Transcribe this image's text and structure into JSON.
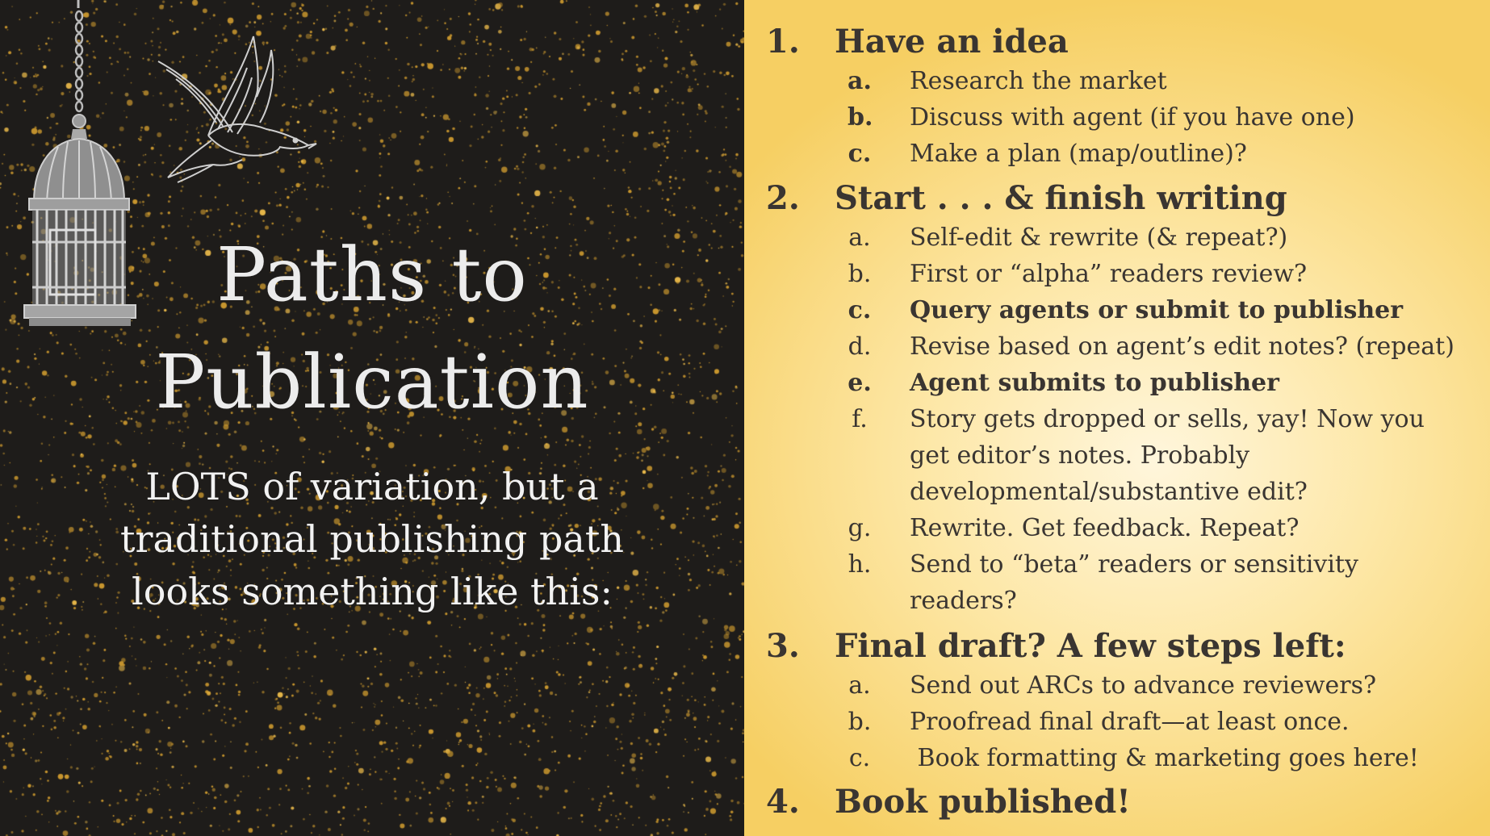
{
  "left": {
    "title_line1": "Paths to",
    "title_line2": "Publication",
    "subtitle_line1": "LOTS of variation, but a",
    "subtitle_line2": "traditional publishing path",
    "subtitle_line3": "looks something like this:",
    "illustrations": [
      "birdcage-icon",
      "swallow-icon"
    ],
    "colors": {
      "background": "#1e1c1a",
      "sparkle": "#c8962e",
      "text": "#ececec"
    }
  },
  "steps": [
    {
      "num": "1.",
      "title": "Have an idea",
      "subs": [
        {
          "letter": "a.",
          "text": "Research the market",
          "bold_letter": true
        },
        {
          "letter": "b.",
          "text": "Discuss with agent (if you have one)",
          "bold_letter": true
        },
        {
          "letter": "c.",
          "text": "Make a plan (map/outline)?",
          "bold_letter": true
        }
      ]
    },
    {
      "num": "2.",
      "title": "Start . . . & finish writing",
      "subs": [
        {
          "letter": "a.",
          "text": "Self-edit & rewrite (& repeat?)"
        },
        {
          "letter": "b.",
          "text": "First or “alpha” readers review?"
        },
        {
          "letter": "c.",
          "text": "Query agents or submit to publisher",
          "bold": true
        },
        {
          "letter": "d.",
          "text": "Revise based on agent’s edit notes? (repeat)"
        },
        {
          "letter": "e.",
          "text": "Agent submits to publisher",
          "bold": true
        },
        {
          "letter": "f.",
          "text": "Story gets dropped or sells, yay! Now you",
          "cont1": "get editor’s notes. Probably",
          "cont2": "developmental/substantive edit?"
        },
        {
          "letter": "g.",
          "text": "Rewrite. Get feedback. Repeat?"
        },
        {
          "letter": "h.",
          "text": "Send to “beta” readers or sensitivity",
          "cont1": "readers?"
        }
      ]
    },
    {
      "num": "3.",
      "title": "Final draft? A few steps left:",
      "subs": [
        {
          "letter": "a.",
          "text": "Send out ARCs to advance reviewers?"
        },
        {
          "letter": "b.",
          "text": "Proofread final draft—at least once."
        },
        {
          "letter": "c.",
          "text": " Book formatting & marketing goes here!"
        }
      ]
    },
    {
      "num": "4.",
      "title": "Book published!"
    }
  ],
  "colors": {
    "list_text": "#3a3531",
    "gold_light": "#fff6dc",
    "gold_dark": "#f6cf63"
  }
}
